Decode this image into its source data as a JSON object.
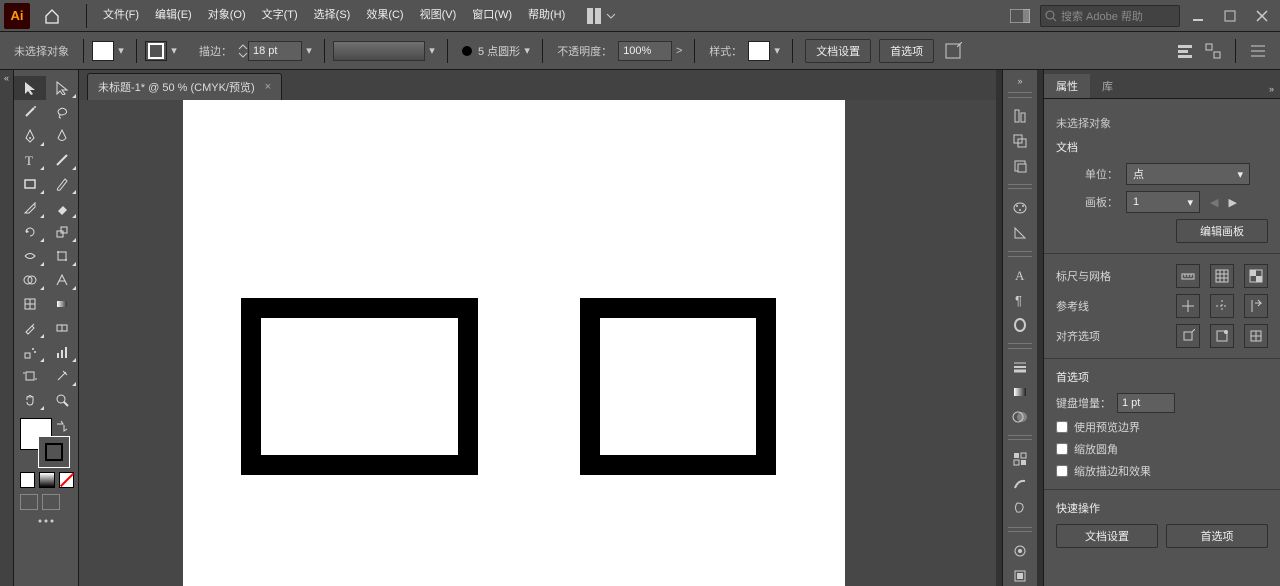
{
  "menubar": {
    "logo": "Ai",
    "items": [
      "文件(F)",
      "编辑(E)",
      "对象(O)",
      "文字(T)",
      "选择(S)",
      "效果(C)",
      "视图(V)",
      "窗口(W)",
      "帮助(H)"
    ],
    "search_placeholder": "搜索 Adobe 帮助"
  },
  "ctrlbar": {
    "selection": "未选择对象",
    "stroke_label": "描边：",
    "stroke_pt": "18 pt",
    "brush_profile": "5 点圆形",
    "opacity_label": "不透明度：",
    "opacity_value": "100%",
    "style_label": "样式：",
    "doc_setup": "文档设置",
    "prefs": "首选项"
  },
  "doctab": {
    "title": "未标题-1* @ 50 % (CMYK/预览)",
    "close": "×"
  },
  "props": {
    "tab_attr": "属性",
    "tab_lib": "库",
    "no_sel": "未选择对象",
    "sec_doc": "文档",
    "unit_label": "单位：",
    "unit_value": "点",
    "artboard_label": "画板：",
    "artboard_value": "1",
    "edit_artboards": "编辑画板",
    "rulers_label": "标尺与网格",
    "guides_label": "参考线",
    "align_label": "对齐选项",
    "sec_prefs": "首选项",
    "kbd_inc_label": "键盘增量：",
    "kbd_inc_value": "1 pt",
    "cb_preview": "使用预览边界",
    "cb_scale_corner": "缩放圆角",
    "cb_scale_stroke": "缩放描边和效果",
    "sec_quick": "快速操作",
    "qa_doc": "文档设置",
    "qa_pref": "首选项"
  }
}
